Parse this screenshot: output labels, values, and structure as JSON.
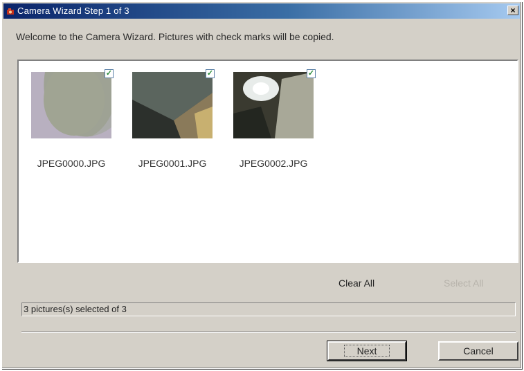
{
  "window": {
    "title": "Camera Wizard Step 1 of 3",
    "close_label": "×"
  },
  "welcome_text": "Welcome to the Camera Wizard. Pictures with check marks will be copied.",
  "pictures": [
    {
      "filename": "JPEG0000.JPG",
      "checked": true,
      "check_glyph": "✓"
    },
    {
      "filename": "JPEG0001.JPG",
      "checked": true,
      "check_glyph": "✓"
    },
    {
      "filename": "JPEG0002.JPG",
      "checked": true,
      "check_glyph": "✓"
    }
  ],
  "actions": {
    "clear_all": "Clear All",
    "select_all": "Select All"
  },
  "status": "3 pictures(s) selected of 3",
  "buttons": {
    "next": "Next",
    "cancel": "Cancel"
  },
  "colors": {
    "title_gradient_start": "#0a246a",
    "dialog_face": "#d4d0c8",
    "disabled_text": "#b8b4ac"
  }
}
